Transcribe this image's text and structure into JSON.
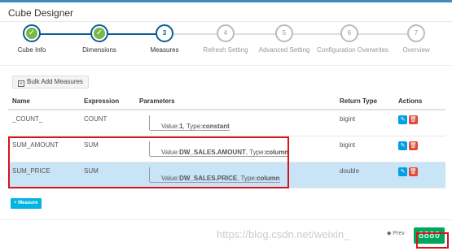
{
  "header": {
    "title": "Cube Designer"
  },
  "wizard": {
    "steps": [
      {
        "num": "✓",
        "label": "Cube Info",
        "state": "done"
      },
      {
        "num": "✓",
        "label": "Dimensions",
        "state": "done"
      },
      {
        "num": "3",
        "label": "Measures",
        "state": "active"
      },
      {
        "num": "4",
        "label": "Refresh Setting",
        "state": "todo"
      },
      {
        "num": "5",
        "label": "Advanced Setting",
        "state": "todo"
      },
      {
        "num": "6",
        "label": "Configuration Overwrites",
        "state": "todo"
      },
      {
        "num": "7",
        "label": "Overview",
        "state": "todo"
      }
    ]
  },
  "toolbar": {
    "bulk_label": "Bulk Add Measures"
  },
  "table": {
    "headers": {
      "name": "Name",
      "expression": "Expression",
      "parameters": "Parameters",
      "return_type": "Return Type",
      "actions": "Actions"
    },
    "rows": [
      {
        "name": "_COUNT_",
        "expression": "COUNT",
        "value_label": "Value:",
        "value": "1",
        "type_label": ", Type:",
        "type": "constant",
        "return_type": "bigint"
      },
      {
        "name": "SUM_AMOUNT",
        "expression": "SUM",
        "value_label": "Value:",
        "value": "DW_SALES.AMOUNT",
        "type_label": ", Type:",
        "type": "column",
        "return_type": "bigint"
      },
      {
        "name": "SUM_PRICE",
        "expression": "SUM",
        "value_label": "Value:",
        "value": "DW_SALES.PRICE",
        "type_label": ", Type:",
        "type": "column",
        "return_type": "double"
      }
    ]
  },
  "add_measure_label": "+ Measure",
  "footer": {
    "prev_label": "◆ Prev",
    "next_label": "8880"
  },
  "watermark": "https://blog.csdn.net/weixin_",
  "colors": {
    "accent": "#0b5e94",
    "done": "#7ab648",
    "selected_row": "#c8e4f6",
    "highlight": "#d9131e",
    "next": "#00a65a"
  }
}
